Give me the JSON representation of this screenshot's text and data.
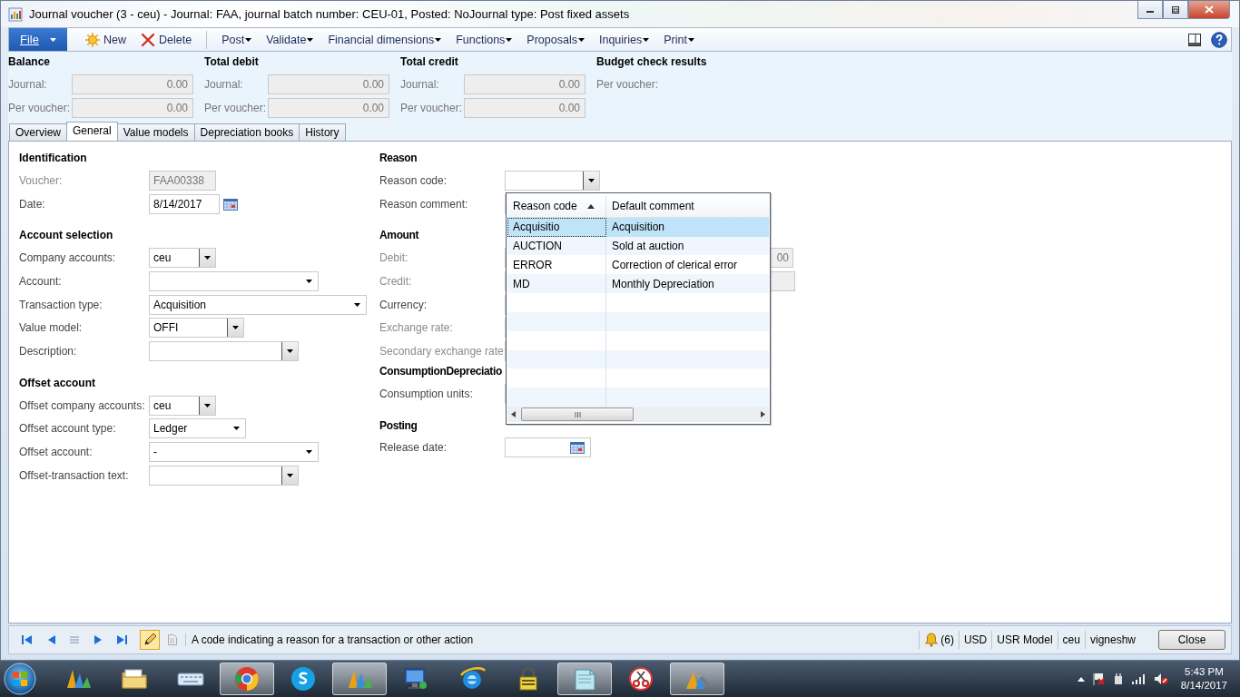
{
  "window": {
    "title": "Journal voucher (3 - ceu) - Journal: FAA, journal batch number: CEU-01, Posted: NoJournal type: Post fixed assets"
  },
  "toolbar": {
    "file": "File",
    "actions": [
      {
        "label": "New",
        "kind": "new"
      },
      {
        "label": "Delete",
        "kind": "delete"
      }
    ],
    "menus": [
      "Post",
      "Validate",
      "Financial dimensions",
      "Functions",
      "Proposals",
      "Inquiries",
      "Print"
    ]
  },
  "summary": [
    {
      "title": "Balance",
      "rows": [
        {
          "label": "Journal:",
          "value": "0.00"
        },
        {
          "label": "Per voucher:",
          "value": "0.00"
        }
      ]
    },
    {
      "title": "Total debit",
      "rows": [
        {
          "label": "Journal:",
          "value": "0.00"
        },
        {
          "label": "Per voucher:",
          "value": "0.00"
        }
      ]
    },
    {
      "title": "Total credit",
      "rows": [
        {
          "label": "Journal:",
          "value": "0.00"
        },
        {
          "label": "Per voucher:",
          "value": "0.00"
        }
      ]
    },
    {
      "title": "Budget check results",
      "rows": [
        {
          "label": "Per voucher:"
        }
      ]
    }
  ],
  "tabs": [
    {
      "label": "Overview",
      "selected": false
    },
    {
      "label": "General",
      "selected": true
    },
    {
      "label": "Value models",
      "selected": false
    },
    {
      "label": "Depreciation books",
      "selected": false
    },
    {
      "label": "History",
      "selected": false
    }
  ],
  "general": {
    "columns": [
      [
        {
          "heading": "Identification",
          "fields": [
            {
              "label": "Voucher:",
              "kind": "text",
              "value": "FAA00338",
              "disabled": true
            },
            {
              "label": "Date:",
              "kind": "date",
              "value": "8/14/2017",
              "disabled": false
            }
          ]
        },
        {
          "heading": "Account selection",
          "fields": [
            {
              "label": "Company accounts:",
              "kind": "combo",
              "value": "ceu",
              "disabled": false
            },
            {
              "label": "Account:",
              "kind": "select",
              "disabled": false
            },
            {
              "label": "Transaction type:",
              "kind": "select",
              "value": "Acquisition",
              "disabled": false
            },
            {
              "label": "Value model:",
              "kind": "combo",
              "value": "OFFI",
              "disabled": false
            },
            {
              "label": "Description:",
              "kind": "combo",
              "disabled": false
            }
          ]
        },
        {
          "heading": "Offset account",
          "fields": [
            {
              "label": "Offset company accounts:",
              "kind": "combo",
              "value": "ceu",
              "disabled": false
            },
            {
              "label": "Offset account type:",
              "kind": "select",
              "value": "Ledger",
              "disabled": false
            },
            {
              "label": "Offset account:",
              "kind": "select",
              "value": "-",
              "disabled": false
            },
            {
              "label": "Offset-transaction text:",
              "kind": "combo",
              "disabled": false
            }
          ]
        }
      ],
      [
        {
          "heading": "Reason",
          "fields": [
            {
              "label": "Reason code:",
              "kind": "combo",
              "disabled": false
            },
            {
              "label": "Reason comment:",
              "kind": "text",
              "disabled": false
            }
          ]
        },
        {
          "heading": "Amount",
          "fields": [
            {
              "label": "Debit:",
              "kind": "text",
              "value": "00",
              "disabled": true
            },
            {
              "label": "Credit:",
              "kind": "text",
              "disabled": true
            },
            {
              "label": "Currency:",
              "kind": "text",
              "disabled": false
            },
            {
              "label": "Exchange rate:",
              "kind": "text",
              "disabled": true
            },
            {
              "label": "Secondary exchange rate:",
              "kind": "text",
              "disabled": true
            }
          ]
        },
        {
          "heading": "ConsumptionDepreciatio",
          "fields": [
            {
              "label": "Consumption units:",
              "kind": "text",
              "disabled": false
            }
          ]
        },
        {
          "heading": "Posting",
          "fields": [
            {
              "label": "Release date:",
              "kind": "datebox",
              "disabled": false
            }
          ]
        }
      ]
    ]
  },
  "reason_lookup": {
    "columns": [
      {
        "label": "Reason code",
        "sorted": true
      },
      {
        "label": "Default comment",
        "sorted": false
      }
    ],
    "rows": [
      {
        "cells": [
          "Acquisitio",
          "Acquisition"
        ],
        "selected": true
      },
      {
        "cells": [
          "AUCTION",
          "Sold at auction"
        ],
        "selected": false
      },
      {
        "cells": [
          "ERROR",
          "Correction of clerical error"
        ],
        "selected": false
      },
      {
        "cells": [
          "MD",
          "Monthly Depreciation"
        ],
        "selected": false
      }
    ]
  },
  "status_bar": {
    "help_text": "A code indicating a reason for a transaction or other action",
    "edit_mode": true,
    "alerts": "(6)",
    "items": [
      "USD",
      "USR Model",
      "ceu",
      "vigneshw"
    ],
    "close": "Close"
  },
  "taskbar": {
    "items": [
      {
        "kind": "bars",
        "open": false
      },
      {
        "kind": "folder",
        "open": false
      },
      {
        "kind": "keyboard",
        "open": false
      },
      {
        "kind": "browser",
        "open": true
      },
      {
        "kind": "chat",
        "open": false
      },
      {
        "kind": "bars",
        "open": true
      },
      {
        "kind": "monitor",
        "open": false
      },
      {
        "kind": "globe",
        "open": false
      },
      {
        "kind": "padlock",
        "open": false
      },
      {
        "kind": "notepad",
        "open": true
      },
      {
        "kind": "scissors",
        "open": false
      },
      {
        "kind": "tools",
        "open": true
      }
    ],
    "time": "5:43 PM",
    "date": "8/14/2017"
  }
}
